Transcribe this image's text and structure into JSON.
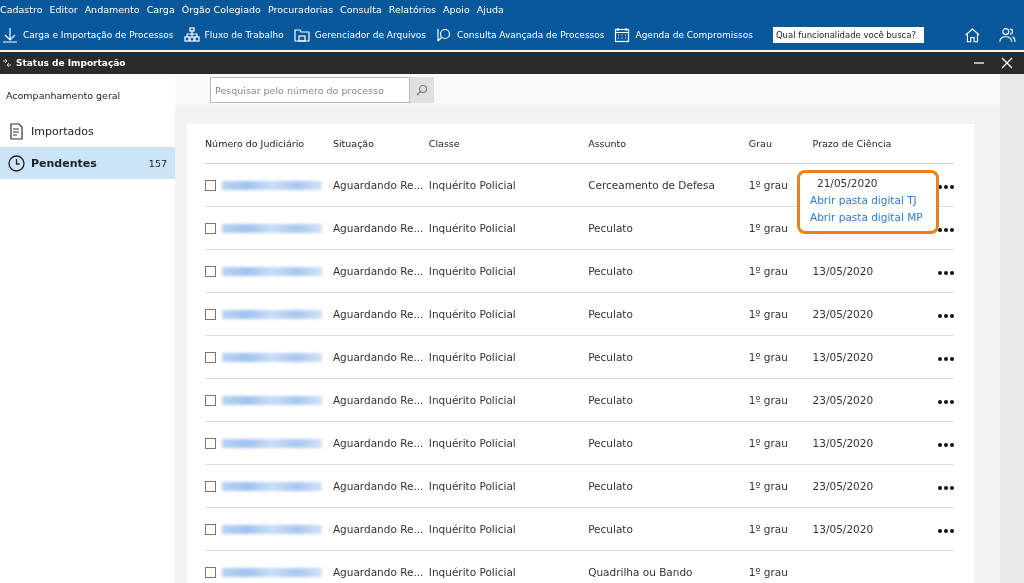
{
  "menu_bar": [
    "Cadastro",
    "Editor",
    "Andamento",
    "Carga",
    "Órgão Colegiado",
    "Procuradorias",
    "Consulta",
    "Relatórios",
    "Apoio",
    "Ajuda"
  ],
  "toolbar": [
    {
      "kind": "download",
      "label": "Carga e Importação de Processos"
    },
    {
      "kind": "flow",
      "label": "Fluxo de Trabalho"
    },
    {
      "kind": "folder",
      "label": "Gerenciador de Arquivos"
    },
    {
      "kind": "search",
      "label": "Consulta Avançada de Processos"
    },
    {
      "kind": "calendar",
      "label": "Agenda de Compromissos"
    }
  ],
  "feature_search": {
    "placeholder": "Qual funcionalidade você busca?"
  },
  "window": {
    "title": "Status de Importação"
  },
  "sidebar": {
    "heading": "Acompanhamento geral",
    "items": [
      {
        "kind": "document",
        "label": "Importados",
        "selected": false
      },
      {
        "kind": "clock",
        "label": "Pendentes",
        "count": "157",
        "selected": true
      }
    ]
  },
  "search": {
    "placeholder": "Pesquisar pelo número do processo"
  },
  "table": {
    "columns": [
      "Número do Judiciário",
      "Situação",
      "Classe",
      "Assunto",
      "Grau",
      "Prazo de Ciência"
    ],
    "rows": [
      {
        "checked": false,
        "situacao": "Aguardando Re...",
        "classe": "Inquérito Policial",
        "assunto": "Cerceamento de Defesa",
        "grau": "1º grau",
        "more": true
      },
      {
        "checked": false,
        "situacao": "Aguardando Re...",
        "classe": "Inquérito Policial",
        "assunto": "Peculato",
        "grau": "1º grau",
        "more": true
      },
      {
        "checked": false,
        "situacao": "Aguardando Re...",
        "classe": "Inquérito Policial",
        "assunto": "Peculato",
        "grau": "1º grau",
        "prazo": "13/05/2020",
        "more": true
      },
      {
        "checked": false,
        "situacao": "Aguardando Re...",
        "classe": "Inquérito Policial",
        "assunto": "Peculato",
        "grau": "1º grau",
        "prazo": "23/05/2020",
        "more": true
      },
      {
        "checked": false,
        "situacao": "Aguardando Re...",
        "classe": "Inquérito Policial",
        "assunto": "Peculato",
        "grau": "1º grau",
        "prazo": "13/05/2020",
        "more": true
      },
      {
        "checked": false,
        "situacao": "Aguardando Re...",
        "classe": "Inquérito Policial",
        "assunto": "Peculato",
        "grau": "1º grau",
        "prazo": "23/05/2020",
        "more": true
      },
      {
        "checked": false,
        "situacao": "Aguardando Re...",
        "classe": "Inquérito Policial",
        "assunto": "Peculato",
        "grau": "1º grau",
        "prazo": "13/05/2020",
        "more": true
      },
      {
        "checked": false,
        "situacao": "Aguardando Re...",
        "classe": "Inquérito Policial",
        "assunto": "Peculato",
        "grau": "1º grau",
        "prazo": "23/05/2020",
        "more": true
      },
      {
        "checked": false,
        "situacao": "Aguardando Re...",
        "classe": "Inquérito Policial",
        "assunto": "Peculato",
        "grau": "1º grau",
        "prazo": "13/05/2020",
        "more": true
      },
      {
        "checked": false,
        "situacao": "Aguardando Re...",
        "classe": "Inquérito Policial",
        "assunto": "Quadrilha ou Bando",
        "grau": "1º grau",
        "more": false
      }
    ]
  },
  "popup": {
    "date": "21/05/2020",
    "items": [
      "Abrir pasta digital TJ",
      "Abrir pasta digital MP"
    ]
  }
}
